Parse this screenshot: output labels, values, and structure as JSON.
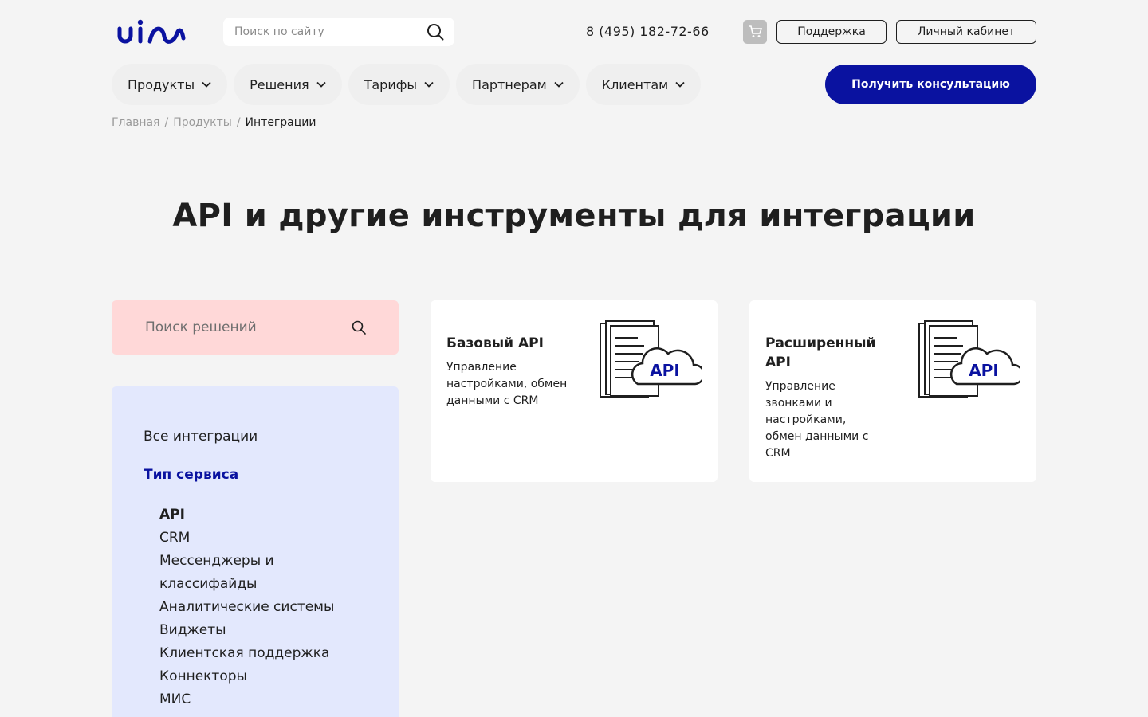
{
  "brand": {
    "logo_text": "uis",
    "accent": "#0a12a0"
  },
  "header": {
    "search_placeholder": "Поиск по сайту",
    "phone": "8 (495) 182-72-66",
    "support_label": "Поддержка",
    "cabinet_label": "Личный кабинет"
  },
  "nav": {
    "items": [
      {
        "label": "Продукты"
      },
      {
        "label": "Решения"
      },
      {
        "label": "Тарифы"
      },
      {
        "label": "Партнерам"
      },
      {
        "label": "Клиентам"
      }
    ],
    "cta_label": "Получить консультацию"
  },
  "breadcrumb": {
    "items": [
      "Главная",
      "Продукты"
    ],
    "separator": "/",
    "current": "Интеграции"
  },
  "page": {
    "title": "API и другие инструменты для интеграции"
  },
  "sidebar": {
    "search_placeholder": "Поиск решений",
    "all_label": "Все интеграции",
    "group_label": "Тип сервиса",
    "items": [
      {
        "label": "API"
      },
      {
        "label": "CRM"
      },
      {
        "label": "Мессенджеры и"
      },
      {
        "label": "классифайды"
      },
      {
        "label": "Аналитические системы"
      },
      {
        "label": "Виджеты"
      },
      {
        "label": "Клиентская поддержка"
      },
      {
        "label": "Коннекторы"
      },
      {
        "label": "МИС"
      }
    ]
  },
  "cards": [
    {
      "title": "Базовый API",
      "description": "Управление настройками, обмен данными с CRM",
      "badge": "API"
    },
    {
      "title": "Расширенный API",
      "description": "Управление звонками и настройками, обмен данными с CRM",
      "badge": "API"
    }
  ]
}
